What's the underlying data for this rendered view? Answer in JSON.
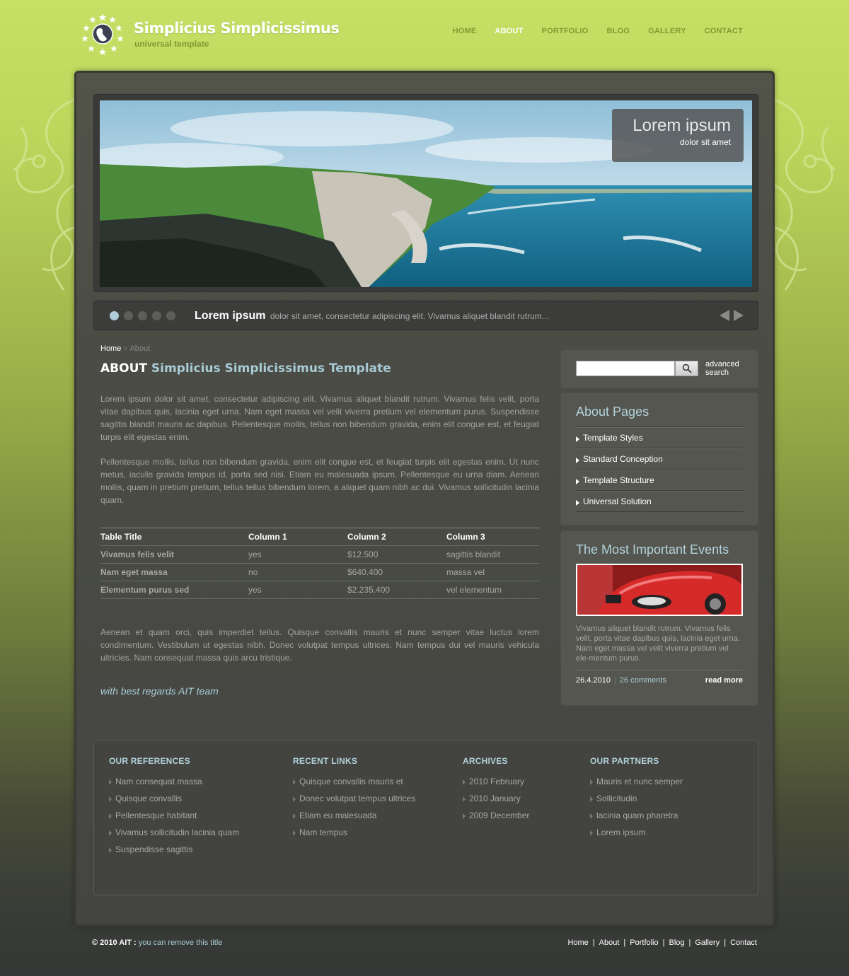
{
  "header": {
    "brand_title": "Simplicius Simplicissimus",
    "brand_subtitle": "universal template",
    "nav": [
      {
        "label": "HOME",
        "active": false
      },
      {
        "label": "ABOUT",
        "active": true
      },
      {
        "label": "PORTFOLIO",
        "active": false
      },
      {
        "label": "BLOG",
        "active": false
      },
      {
        "label": "GALLERY",
        "active": false
      },
      {
        "label": "CONTACT",
        "active": false
      }
    ]
  },
  "slider": {
    "caption_title": "Lorem ipsum",
    "caption_subtitle": "dolor sit amet",
    "slide_title": "Lorem ipsum",
    "slide_text": "dolor sit amet, consectetur adipiscing elit. Vivamus aliquet blandit rutrum...",
    "active_dot": 1,
    "dot_count": 5
  },
  "content": {
    "breadcrumb": {
      "home": "Home",
      "separator": "»",
      "current": "About"
    },
    "title_prefix": "ABOUT",
    "title_rest": "Simplicius Simplicissimus Template",
    "para1": "Lorem ipsum dolor sit amet, consectetur adipiscing elit. Vivamus aliquet blandit rutrum. Vivamus felis velit, porta vitae dapibus quis, lacinia eget urna. Nam eget massa vel velit viverra pretium vel elementum purus. Suspendisse sagittis blandit mauris ac dapibus. Pellentesque mollis, tellus non bibendum gravida, enim elit congue est, et feugiat turpis elit egestas enim.",
    "para2": "Pellentesque mollis, tellus non bibendum gravida, enim elit congue est, et feugiat turpis elit egestas enim. Ut nunc metus, iaculis gravida tempus id, porta sed nisi. Etiam eu malesuada ipsum. Pellentesque eu urna diam. Aenean mollis, quam in pretium pretium, tellus tellus bibendum lorem, a aliquet quam nibh ac dui. Vivamus sollicitudin lacinia quam.",
    "table": {
      "headers": [
        "Table Title",
        "Column 1",
        "Column 2",
        "Column 3"
      ],
      "rows": [
        [
          "Vivamus felis velit",
          "yes",
          "$12.500",
          "sagittis blandit"
        ],
        [
          "Nam eget massa",
          "no",
          "$640.400",
          "massa vel"
        ],
        [
          "Elementum purus sed",
          "yes",
          "$2.235.400",
          "vel elementum"
        ]
      ]
    },
    "para3": "Aenean et quam orci, quis imperdiet tellus. Quisque convallis mauris et nunc semper vitae luctus lorem condimentum. Vestibulum ut egestas nibh. Donec volutpat tempus ultrices. Nam tempus dui vel mauris vehicula ultricies. Nam consequat massa quis arcu tristique.",
    "regards": "with best regards AIT team"
  },
  "sidebar": {
    "search": {
      "placeholder": "",
      "advanced_line1": "advanced",
      "advanced_line2": "search"
    },
    "about_pages": {
      "title": "About Pages",
      "items": [
        "Template Styles",
        "Standard Conception",
        "Template Structure",
        "Universal Solution"
      ]
    },
    "events": {
      "title": "The Most Important Events",
      "text": "Vivamus aliquet blandit rutrum. Vivamus felis velit, porta vitae dapibus quis, lacinia eget urna. Nam eget massa vel velit viverra pretium vel ele-mentum purus.",
      "date": "26.4.2010",
      "separator": "|",
      "comments": "26 comments",
      "read_more": "read more"
    }
  },
  "footer": {
    "columns": [
      {
        "title": "OUR REFERENCES",
        "items": [
          "Nam consequat massa",
          "Quisque convallis",
          "Pellentesque habitant",
          "Vivamus sollicitudin lacinia quam",
          "Suspendisse sagittis"
        ]
      },
      {
        "title": "RECENT LINKS",
        "items": [
          "Quisque convallis mauris et",
          "Donec volutpat tempus ultrices",
          "Etiam eu malesuada",
          "Nam tempus"
        ]
      },
      {
        "title": "ARCHIVES",
        "items": [
          "2010 February",
          "2010 January",
          "2009 December"
        ]
      },
      {
        "title": "OUR PARTNERS",
        "items": [
          "Mauris et nunc semper",
          "Sollicitudin",
          "lacinia quam pharetra",
          "Lorem ipsum"
        ]
      }
    ]
  },
  "bottom": {
    "copyright": "© 2010 AIT :",
    "copyright_note": "you can remove this title",
    "links": [
      "Home",
      "About",
      "Portfolio",
      "Blog",
      "Gallery",
      "Contact"
    ],
    "separator": "|"
  },
  "colors": {
    "bg_top": "#c6e066",
    "bg_bottom": "#353736",
    "accent_light_blue": "#a8cbd6",
    "nav_green": "#7f9a30"
  }
}
